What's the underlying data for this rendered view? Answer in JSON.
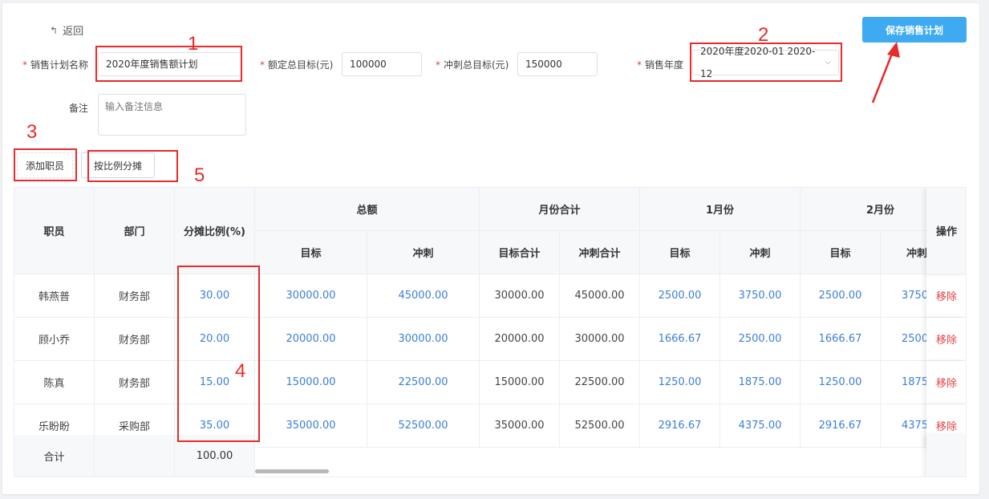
{
  "header": {
    "back_label": "返回",
    "save_label": "保存销售计划"
  },
  "form": {
    "name_label": "销售计划名称",
    "name_value": "2020年度销售额计划",
    "quota_label": "额定总目标(元)",
    "quota_value": "100000",
    "sprint_label": "冲刺总目标(元)",
    "sprint_value": "150000",
    "year_label": "销售年度",
    "year_value": "2020年度2020-01 2020-12",
    "note_label": "备注",
    "note_placeholder": "输入备注信息"
  },
  "toolbar": {
    "add_label": "添加职员",
    "ratio_label": "按比例分摊"
  },
  "annotations": [
    "1",
    "2",
    "3",
    "4",
    "5"
  ],
  "table": {
    "headers": {
      "employee": "职员",
      "dept": "部门",
      "ratio": "分摊比例(%)",
      "total": "总额",
      "month_sum": "月份合计",
      "jan": "1月份",
      "feb": "2月份",
      "target": "目标",
      "sprint": "冲刺",
      "target_sum": "目标合计",
      "sprint_sum": "冲刺合计",
      "target_b": "目标",
      "sprint_b": "冲刺",
      "target_c": "目标",
      "sprint_c": "冲刺",
      "ops": "操作"
    },
    "rows": [
      {
        "name": "韩燕普",
        "dept": "财务部",
        "ratio": "30.00",
        "t": "30000.00",
        "s": "45000.00",
        "ts": "30000.00",
        "ss": "45000.00",
        "j1t": "2500.00",
        "j1s": "3750.00",
        "f2t": "2500.00",
        "f2s": "3750",
        "op": "移除"
      },
      {
        "name": "顾小乔",
        "dept": "财务部",
        "ratio": "20.00",
        "t": "20000.00",
        "s": "30000.00",
        "ts": "20000.00",
        "ss": "30000.00",
        "j1t": "1666.67",
        "j1s": "2500.00",
        "f2t": "1666.67",
        "f2s": "2500",
        "op": "移除"
      },
      {
        "name": "陈真",
        "dept": "财务部",
        "ratio": "15.00",
        "t": "15000.00",
        "s": "22500.00",
        "ts": "15000.00",
        "ss": "22500.00",
        "j1t": "1250.00",
        "j1s": "1875.00",
        "f2t": "1250.00",
        "f2s": "1875",
        "op": "移除"
      },
      {
        "name": "乐盼盼",
        "dept": "采购部",
        "ratio": "35.00",
        "t": "35000.00",
        "s": "52500.00",
        "ts": "35000.00",
        "ss": "52500.00",
        "j1t": "2916.67",
        "j1s": "4375.00",
        "f2t": "2916.67",
        "f2s": "4375",
        "op": "移除"
      }
    ],
    "footer": {
      "label": "合计",
      "ratio_total": "100.00"
    }
  }
}
